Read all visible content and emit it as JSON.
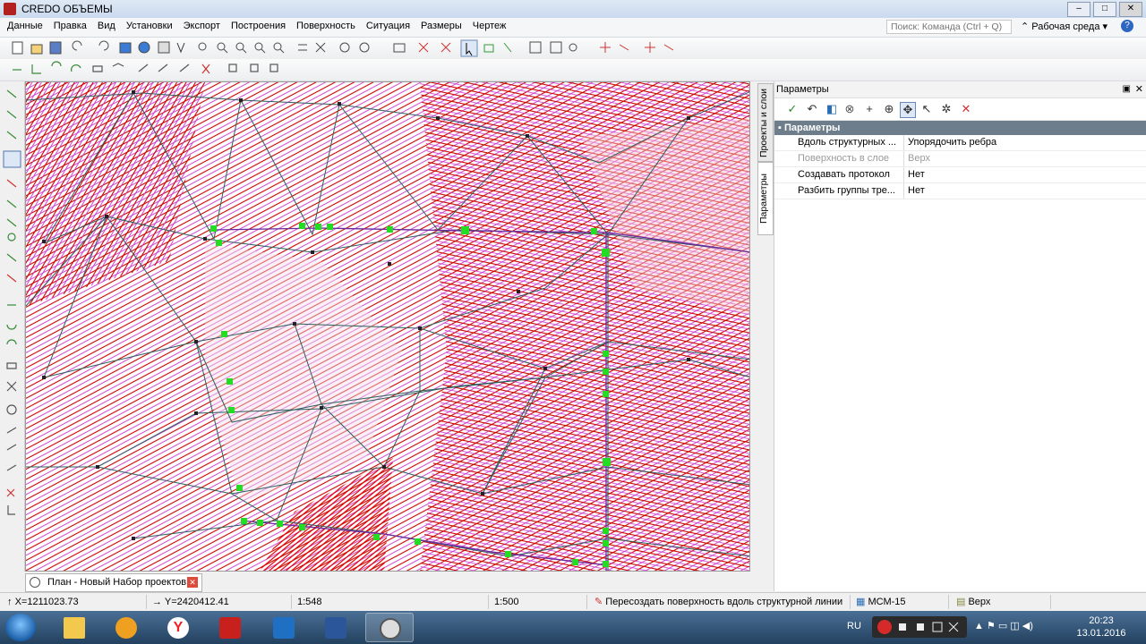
{
  "window": {
    "title": "CREDO ОБЪЕМЫ",
    "buttons": [
      "–",
      "□",
      "✕"
    ]
  },
  "menu": {
    "items": [
      "Данные",
      "Правка",
      "Вид",
      "Установки",
      "Экспорт",
      "Построения",
      "Поверхность",
      "Ситуация",
      "Размеры",
      "Чертеж"
    ],
    "search_placeholder": "Поиск: Команда (Ctrl + Q)",
    "workspace": "Рабочая среда",
    "help": "?"
  },
  "side_tabs": [
    "Проекты и слои",
    "Параметры"
  ],
  "panel": {
    "title": "Параметры",
    "section": "Параметры",
    "rows": [
      {
        "key": "Вдоль структурных ...",
        "value": "Упорядочить ребра",
        "disabled": false
      },
      {
        "key": "Поверхность в слое",
        "value": "Верх",
        "disabled": true
      },
      {
        "key": "Создавать протокол",
        "value": "Нет",
        "disabled": false
      },
      {
        "key": "Разбить группы тре...",
        "value": "Нет",
        "disabled": false
      }
    ]
  },
  "document_tab": {
    "label": "План - Новый Набор проектов"
  },
  "status": {
    "x": "X=1211023.73",
    "y": "Y=2420412.41",
    "scale1": "1:548",
    "scale2": "1:500",
    "command": "Пересоздать поверхность вдоль структурной линии",
    "system": "МСМ-15",
    "layer": "Верх"
  },
  "taskbar": {
    "lang": "RU",
    "time": "20:23",
    "date": "13.01.2016"
  },
  "colors": {
    "contour_red": "#cc0000",
    "contour_magenta": "#cc33cc",
    "edge": "#2c5f5f",
    "node": "#22dd22",
    "section_header": "#6e7d8c"
  }
}
